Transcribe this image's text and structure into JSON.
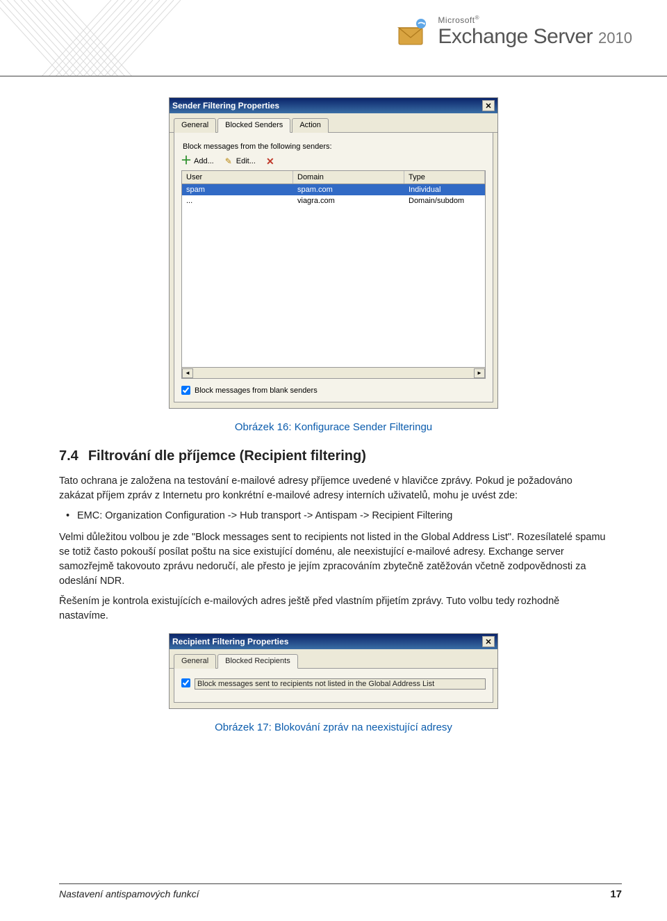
{
  "brand": {
    "microsoft": "Microsoft",
    "name": "Exchange Server",
    "year": "2010"
  },
  "dialog1": {
    "title": "Sender Filtering Properties",
    "tabs": {
      "general": "General",
      "blocked": "Blocked Senders",
      "action": "Action"
    },
    "panel_label": "Block messages from the following senders:",
    "toolbar": {
      "add": "Add...",
      "edit": "Edit..."
    },
    "columns": {
      "user": "User",
      "domain": "Domain",
      "type": "Type"
    },
    "rows": [
      {
        "user": "spam",
        "domain": "spam.com",
        "type": "Individual"
      },
      {
        "user": "...",
        "domain": "viagra.com",
        "type": "Domain/subdom"
      }
    ],
    "checkbox": "Block messages from blank senders"
  },
  "caption1": "Obrázek 16: Konfigurace Sender Filteringu",
  "section": {
    "num": "7.4",
    "title": "Filtrování dle příjemce (Recipient filtering)"
  },
  "para1": "Tato ochrana je založena na testování e-mailové adresy příjemce uvedené v hlavičce zprávy. Pokud je požadováno zakázat příjem zpráv z Internetu pro konkrétní e-mailové adresy interních uživatelů, mohu je uvést zde:",
  "bullet1": "EMC: Organization Configuration -> Hub transport -> Antispam -> Recipient Filtering",
  "para2": "Velmi důležitou volbou je zde \"Block messages sent to recipients not listed in the Global Address List\". Rozesílatelé spamu se totiž často pokouší posílat poštu na sice existující doménu, ale neexistující e-mailové adresy. Exchange server samozřejmě takovouto zprávu nedoručí, ale přesto je jejím zpracováním zbytečně zatěžován včetně zodpovědnosti za odeslání NDR.",
  "para3": "Řešením je kontrola existujících e-mailových adres ještě před vlastním přijetím zprávy. Tuto volbu tedy rozhodně nastavíme.",
  "dialog2": {
    "title": "Recipient Filtering Properties",
    "tabs": {
      "general": "General",
      "blocked": "Blocked Recipients"
    },
    "checkbox": "Block messages sent to recipients not listed in the Global Address List"
  },
  "caption2": "Obrázek 17: Blokování zpráv na neexistující adresy",
  "footer": {
    "left": "Nastavení antispamových funkcí",
    "page": "17"
  }
}
